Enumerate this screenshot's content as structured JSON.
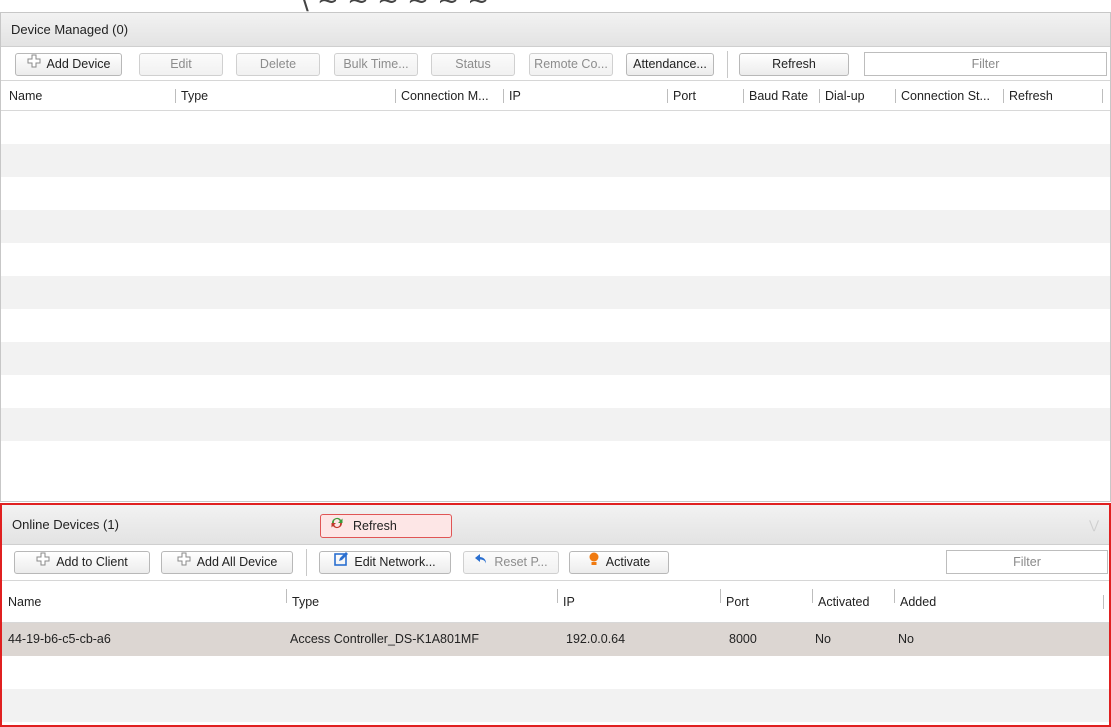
{
  "upper": {
    "title": "Device Managed (0)",
    "toolbar": {
      "add_device": "Add Device",
      "edit": "Edit",
      "delete": "Delete",
      "bulk_time": "Bulk Time...",
      "status": "Status",
      "remote_config": "Remote Co...",
      "attendance": "Attendance...",
      "refresh": "Refresh",
      "filter_placeholder": "Filter"
    },
    "columns": [
      "Name",
      "Type",
      "Connection M...",
      "IP",
      "Port",
      "Baud Rate",
      "Dial-up",
      "Connection St...",
      "Refresh"
    ],
    "rows": []
  },
  "lower": {
    "title": "Online Devices (1)",
    "refresh": "Refresh",
    "toolbar": {
      "add_to_client": "Add to Client",
      "add_all_device": "Add All Device",
      "edit_network": "Edit Network...",
      "reset_password": "Reset P...",
      "activate": "Activate",
      "filter_placeholder": "Filter"
    },
    "columns": [
      "Name",
      "Type",
      "IP",
      "Port",
      "Activated",
      "Added"
    ],
    "rows": [
      {
        "name": "44-19-b6-c5-cb-a6",
        "type": "Access Controller_DS-K1A801MF",
        "ip": "192.0.0.64",
        "port": "8000",
        "activated": "No",
        "added": "No"
      }
    ]
  },
  "colors": {
    "highlight_border": "#e02020",
    "selected_row": "#dcd6d2",
    "alt_row": "#f2f2f2",
    "activate_icon": "#f07a10",
    "refresh_icon": "#3a9a3a",
    "edit_icon": "#2a6fd0",
    "reset_icon": "#2a6fd0"
  }
}
